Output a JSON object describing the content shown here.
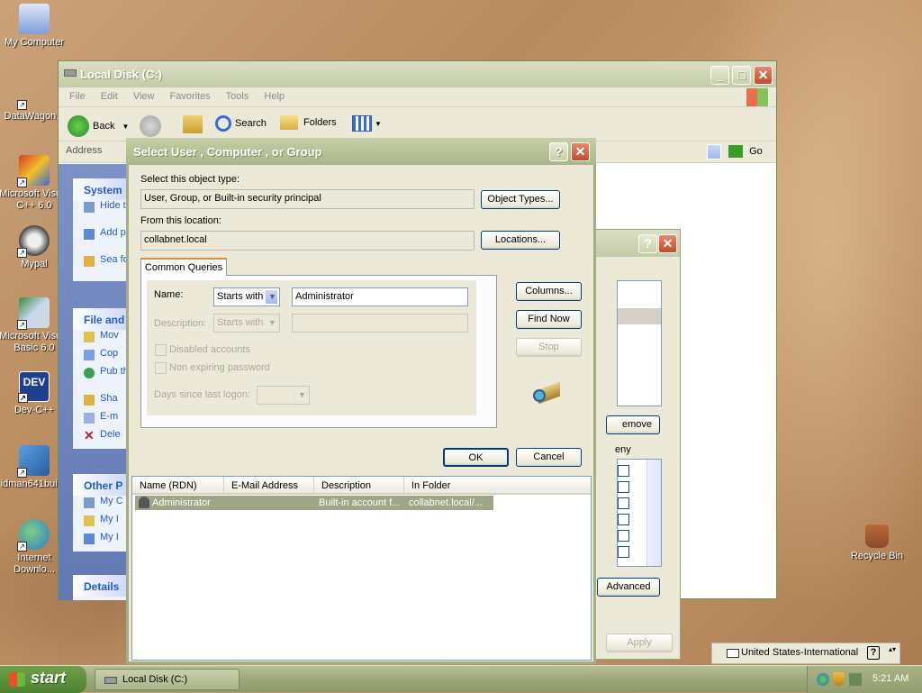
{
  "desktop": {
    "icons": [
      {
        "label": "My Computer"
      },
      {
        "label": "DataWagon..."
      },
      {
        "label": "Microsoft Visual C++ 6.0"
      },
      {
        "label": "Mypal"
      },
      {
        "label": "Microsoft Visual Basic 6.0"
      },
      {
        "label": "Dev-C++"
      },
      {
        "label": "idman641buil..."
      },
      {
        "label": "Internet Downlo..."
      },
      {
        "label": "Recycle Bin"
      }
    ]
  },
  "explorer": {
    "title": "Local Disk (C:)",
    "menu": [
      "File",
      "Edit",
      "View",
      "Favorites",
      "Tools",
      "Help"
    ],
    "toolbar": {
      "back": "Back",
      "search": "Search",
      "folders": "Folders"
    },
    "address_label": "Address",
    "go_label": "Go",
    "left_pane": {
      "system": {
        "title": "System",
        "items": [
          "Hide this",
          "Add prog",
          "Sea fold"
        ]
      },
      "file": {
        "title": "File and",
        "items": [
          "Mov",
          "Cop",
          "Pub the",
          "Sha",
          "E-m",
          "Dele"
        ]
      },
      "other": {
        "title": "Other P",
        "items": [
          "My C",
          "My I",
          "My I"
        ]
      },
      "details": {
        "title": "Details"
      }
    }
  },
  "back_dialog": {
    "remove_label": "emove",
    "deny_label": "eny",
    "advanced_label": "Advanced",
    "apply_label": "Apply"
  },
  "dialog": {
    "title": "Select User , Computer , or Group",
    "object_type_label": "Select this object type:",
    "object_type_value": "User, Group, or Built-in security principal",
    "object_types_button": "Object Types...",
    "location_label": "From this location:",
    "location_value": "collabnet.local",
    "locations_button": "Locations...",
    "tab_label": "Common Queries",
    "name_label": "Name:",
    "name_mode": "Starts with",
    "name_value": "Administrator",
    "description_label": "Description:",
    "description_mode": "Starts with",
    "disabled_accounts": "Disabled accounts",
    "non_expiring": "Non expiring password",
    "days_label": "Days since last logon:",
    "columns_button": "Columns...",
    "find_now_button": "Find Now",
    "stop_button": "Stop",
    "ok_button": "OK",
    "cancel_button": "Cancel",
    "results": {
      "headers": [
        "Name (RDN)",
        "E-Mail Address",
        "Description",
        "In Folder"
      ],
      "rows": [
        {
          "name": "Administrator",
          "email": "",
          "description": "Built-in account f...",
          "folder": "collabnet.local/..."
        }
      ]
    }
  },
  "taskbar": {
    "start_label": "start",
    "task_label": "Local Disk (C:)",
    "language": "United States-International",
    "clock": "5:21 AM"
  }
}
